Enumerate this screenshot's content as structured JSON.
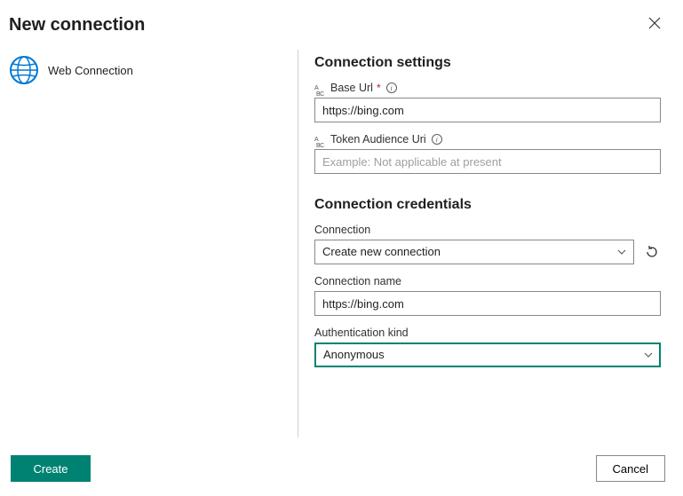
{
  "header": {
    "title": "New connection"
  },
  "left": {
    "item_label": "Web Connection"
  },
  "settings": {
    "section_title": "Connection settings",
    "base_url": {
      "label": "Base Url",
      "value": "https://bing.com"
    },
    "token_audience": {
      "label": "Token Audience Uri",
      "value": "",
      "placeholder": "Example: Not applicable at present"
    }
  },
  "credentials": {
    "section_title": "Connection credentials",
    "connection": {
      "label": "Connection",
      "selected": "Create new connection"
    },
    "connection_name": {
      "label": "Connection name",
      "value": "https://bing.com"
    },
    "auth_kind": {
      "label": "Authentication kind",
      "selected": "Anonymous"
    }
  },
  "footer": {
    "create": "Create",
    "cancel": "Cancel"
  },
  "colors": {
    "primary": "#008272"
  }
}
